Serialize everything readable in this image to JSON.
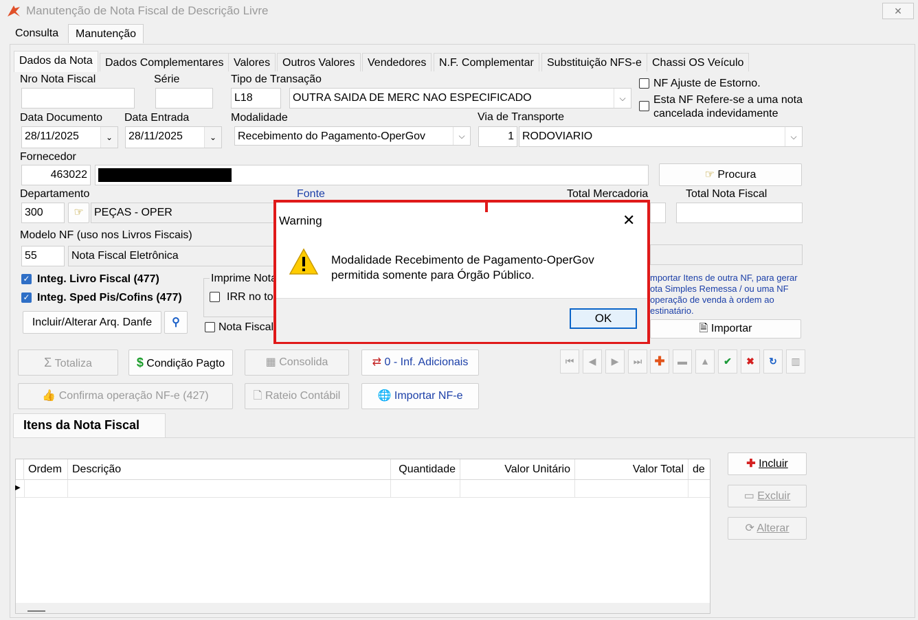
{
  "window": {
    "title": "Manutenção de Nota Fiscal de Descrição Livre",
    "close_label": "✕"
  },
  "main_tabs": [
    "Consulta",
    "Manutenção"
  ],
  "sub_tabs": [
    "Dados da Nota",
    "Dados Complementares",
    "Valores",
    "Outros Valores",
    "Vendedores",
    "N.F. Complementar",
    "Substituição NFS-e",
    "Chassi OS Veículo"
  ],
  "form": {
    "nro_nota_label": "Nro Nota Fiscal",
    "nro_nota_value": "",
    "serie_label": "Série",
    "serie_value": "",
    "tipo_transacao_label": "Tipo de Transação",
    "tipo_transacao_code": "L18",
    "tipo_transacao_desc": "OUTRA SAIDA DE MERC NAO ESPECIFICADO",
    "nf_ajuste_label": "NF Ajuste de Estorno.",
    "nf_refere_label_1": "Esta NF Refere-se a uma nota",
    "nf_refere_label_2": "cancelada indevidamente",
    "data_documento_label": "Data Documento",
    "data_documento_value": "28/11/2025",
    "data_entrada_label": "Data Entrada",
    "data_entrada_value": "28/11/2025",
    "modalidade_label": "Modalidade",
    "modalidade_value": "Recebimento do Pagamento-OperGov",
    "via_transporte_label": "Via de Transporte",
    "via_transporte_code": "1",
    "via_transporte_desc": "RODOVIARIO",
    "fornecedor_label": "Fornecedor",
    "fornecedor_code": "463022",
    "procura_label": "Procura",
    "departamento_label": "Departamento",
    "departamento_code": "300",
    "departamento_desc": "PEÇAS - OPER",
    "fonte_label": "Fonte",
    "total_mercadoria_label": "Total Mercadoria",
    "total_nota_label": "Total Nota Fiscal",
    "modelo_nf_label": "Modelo NF (uso nos Livros Fiscais)",
    "modelo_nf_code": "55",
    "modelo_nf_desc": "Nota Fiscal Eletrônica",
    "integ_livro_label": "Integ. Livro Fiscal (477)",
    "integ_sped_label": "Integ. Sped Pis/Cofins (477)",
    "imprime_nota_label": "Imprime Nota",
    "irr_label": "IRR no to",
    "nota_fiscal_chk_label": "Nota Fiscal",
    "incluir_danfe_label": "Incluir/Alterar Arq. Danfe",
    "importar_info_1": "mportar Itens de outra NF, para gerar",
    "importar_info_2": "ota Simples Remessa / ou uma NF",
    "importar_info_3": "operação de venda à ordem ao",
    "importar_info_4": "estinatário.",
    "importar_label": "Importar"
  },
  "actions": {
    "totaliza": "Totaliza",
    "condicao_pagto": "Condição Pagto",
    "consolida": "Consolida",
    "inf_adicionais": "0 - Inf. Adicionais",
    "confirma_nfe": "Confirma operação NF-e (427)",
    "rateio": "Rateio Contábil",
    "importar_nfe": "Importar NF-e"
  },
  "items": {
    "title": "Itens da Nota Fiscal",
    "columns": [
      "Ordem",
      "Descrição",
      "Quantidade",
      "Valor Unitário",
      "Valor Total",
      "de"
    ],
    "incluir": "Incluir",
    "excluir": "Excluir",
    "alterar": "Alterar"
  },
  "dialog": {
    "title": "Warning",
    "close": "✕",
    "message_line1": "Modalidade Recebimento de Pagamento-OperGov",
    "message_line2": "permitida somente para Órgão Público.",
    "ok": "OK"
  },
  "colors": {
    "highlight_border": "#e01919",
    "checkbox_blue": "#2f6fc6",
    "link_blue": "#1b3fa8"
  }
}
